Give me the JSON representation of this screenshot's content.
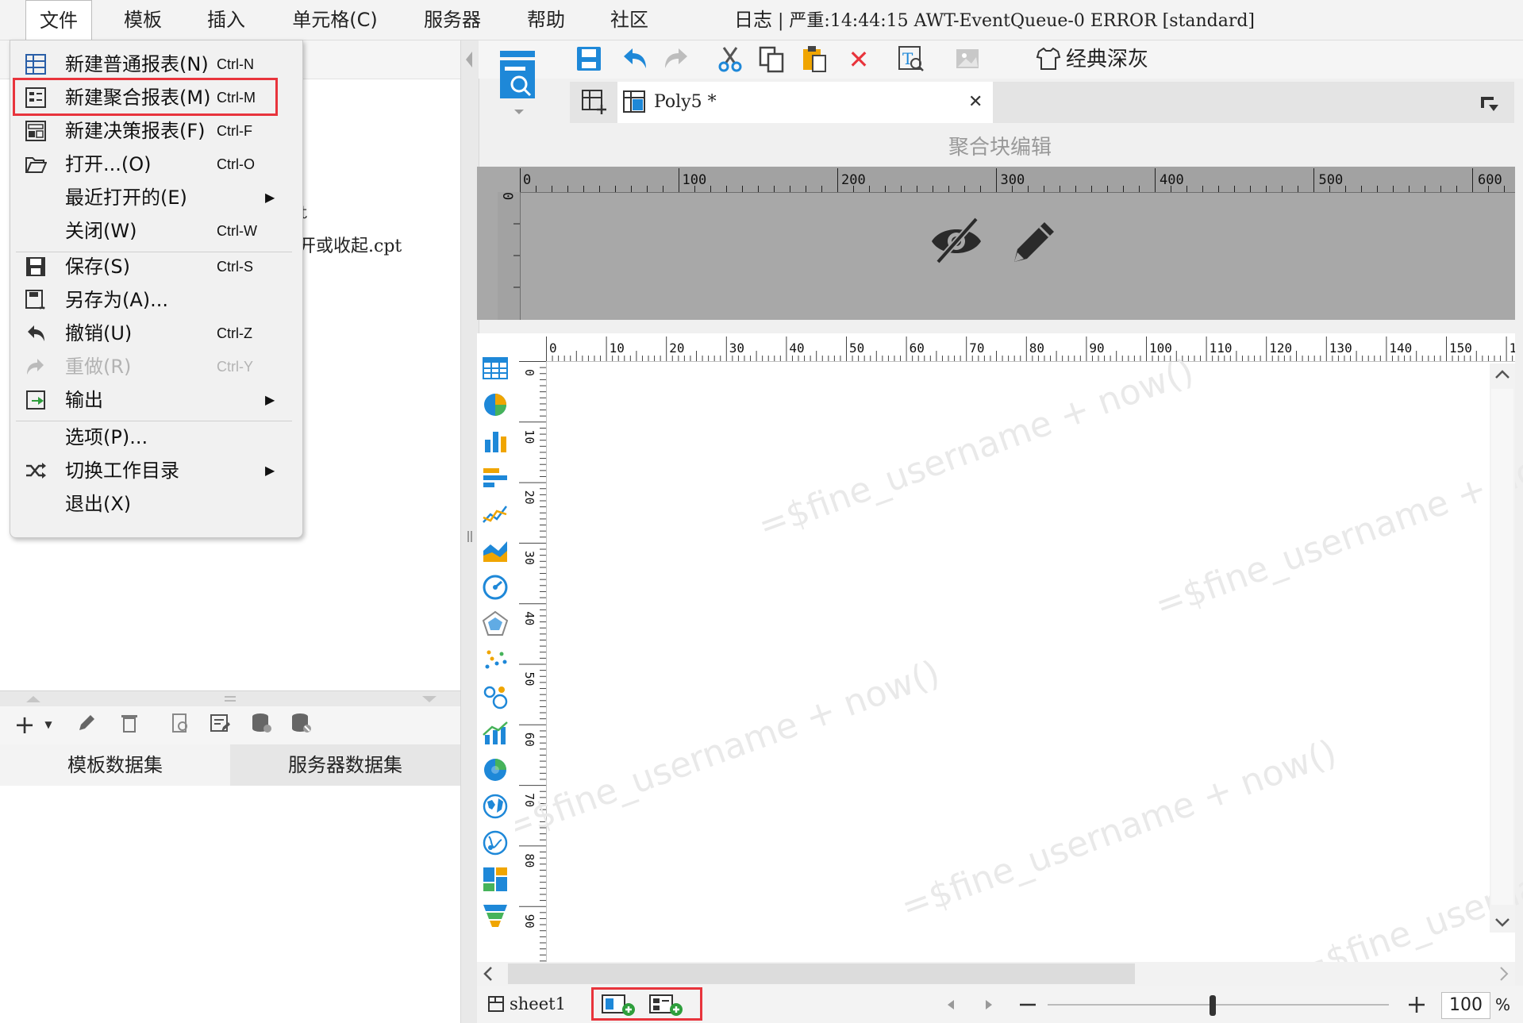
{
  "menubar": {
    "items": [
      "文件",
      "模板",
      "插入",
      "单元格(C)",
      "服务器",
      "帮助",
      "社区"
    ],
    "log_label": "日志",
    "log_message": "| 严重:14:44:15 AWT-EventQueue-0 ERROR [standard]"
  },
  "file_menu": {
    "items": [
      {
        "label": "新建普通报表(N)",
        "shortcut": "Ctrl-N",
        "icon": "grid-report-icon"
      },
      {
        "label": "新建聚合报表(M)",
        "shortcut": "Ctrl-M",
        "icon": "poly-report-icon"
      },
      {
        "label": "新建决策报表(F)",
        "shortcut": "Ctrl-F",
        "icon": "form-report-icon"
      },
      {
        "label": "打开...(O)",
        "shortcut": "Ctrl-O",
        "icon": "folder-open-icon"
      },
      {
        "label": "最近打开的(E)",
        "shortcut": "",
        "icon": ""
      },
      {
        "label": "关闭(W)",
        "shortcut": "Ctrl-W",
        "icon": ""
      },
      {
        "label": "保存(S)",
        "shortcut": "Ctrl-S",
        "icon": "save-icon"
      },
      {
        "label": "另存为(A)...",
        "shortcut": "",
        "icon": "save-as-icon"
      },
      {
        "label": "撤销(U)",
        "shortcut": "Ctrl-Z",
        "icon": "undo-icon"
      },
      {
        "label": "重做(R)",
        "shortcut": "Ctrl-Y",
        "icon": "redo-icon"
      },
      {
        "label": "输出",
        "shortcut": "",
        "icon": "export-icon"
      },
      {
        "label": "选项(P)...",
        "shortcut": "",
        "icon": ""
      },
      {
        "label": "切换工作目录",
        "shortcut": "",
        "icon": "shuffle-icon"
      },
      {
        "label": "退出(X)",
        "shortcut": "",
        "icon": ""
      }
    ],
    "submenu_arrow": "▶"
  },
  "left_panel": {
    "tree_fragment_1": "t",
    "tree_fragment_2": "开或收起.cpt",
    "dataset_tabs": [
      "模板数据集",
      "服务器数据集"
    ]
  },
  "toolbar": {
    "theme_label": "经典深灰"
  },
  "tab": {
    "title": "Poly5 *",
    "close": "✕"
  },
  "poly_editor": {
    "label": "聚合块编辑",
    "ruler_top": [
      "0",
      "100",
      "200",
      "300",
      "400",
      "500",
      "600"
    ],
    "ruler_left": [
      "0"
    ]
  },
  "sheet": {
    "ruler_top": [
      "0",
      "10",
      "20",
      "30",
      "40",
      "50",
      "60",
      "70",
      "80",
      "90",
      "100",
      "110",
      "120",
      "130",
      "140",
      "150",
      "1"
    ],
    "ruler_left": [
      "0",
      "10",
      "20",
      "30",
      "40",
      "50",
      "60",
      "70",
      "80",
      "90"
    ],
    "watermark": "=$fine_username + now()"
  },
  "statusbar": {
    "sheet_name": "sheet1",
    "zoom_value": "100",
    "zoom_unit": "%"
  },
  "colors": {
    "highlight": "#e8343c",
    "accent_blue": "#1e88d8"
  }
}
